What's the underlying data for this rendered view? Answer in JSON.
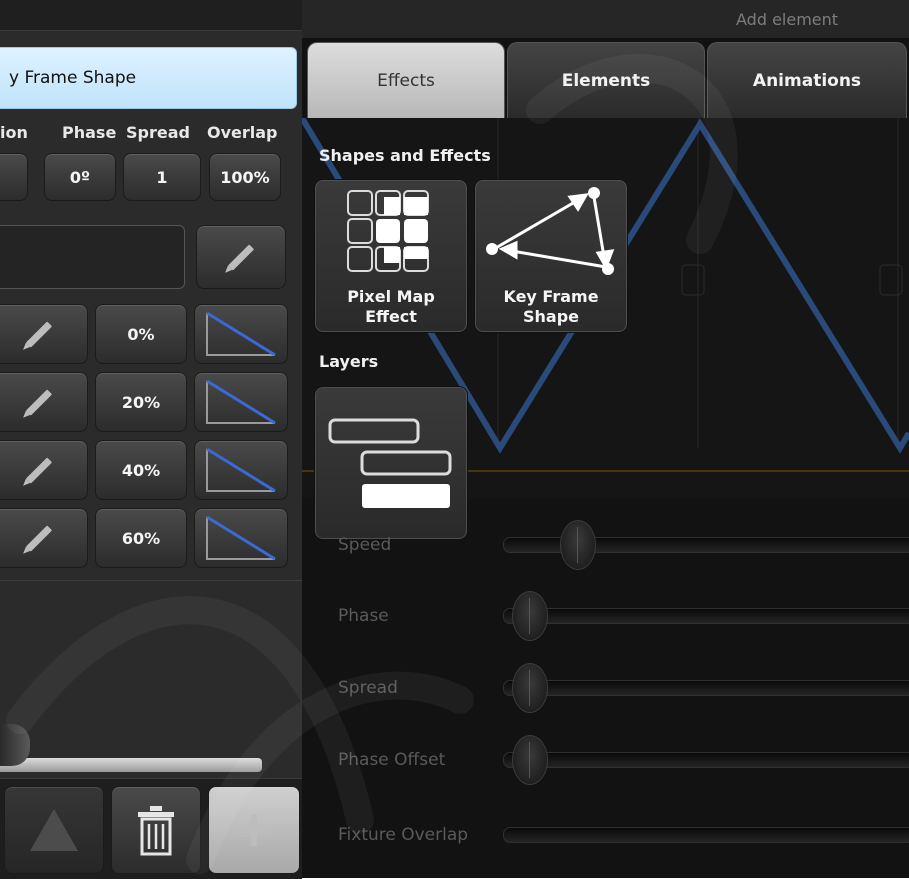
{
  "header": {
    "add_element": "Add element"
  },
  "left_panel": {
    "name_value": "y Frame Shape",
    "columns": [
      "ion",
      "Phase",
      "Spread",
      "Overlap"
    ],
    "values": {
      "phase": "0º",
      "spread": "1",
      "overlap": "100%"
    },
    "layer_rows": [
      {
        "percent": "0%"
      },
      {
        "percent": "20%"
      },
      {
        "percent": "40%"
      },
      {
        "percent": "60%"
      }
    ],
    "icons": {
      "edit": "pencil-icon",
      "ramp": "ramp-curve-icon",
      "up": "triangle-up-icon",
      "delete": "trash-icon",
      "add": "plus-icon"
    }
  },
  "tabs": [
    {
      "label": "Effects",
      "active": true
    },
    {
      "label": "Elements",
      "active": false
    },
    {
      "label": "Animations",
      "active": false
    }
  ],
  "effects_panel": {
    "shapes_title": "Shapes and Effects",
    "tiles": [
      {
        "label_1": "Pixel Map",
        "label_2": "Effect",
        "icon": "pixel-map-icon"
      },
      {
        "label_1": "Key Frame",
        "label_2": "Shape",
        "icon": "key-frame-shape-icon"
      }
    ],
    "layers_title": "Layers",
    "layers_icon": "layers-icon"
  },
  "sliders": [
    {
      "label": "Speed",
      "value": 0.13
    },
    {
      "label": "Phase",
      "value": 0.0
    },
    {
      "label": "Spread",
      "value": 0.0
    },
    {
      "label": "Phase Offset",
      "value": 0.0
    },
    {
      "label": "Fixture Overlap",
      "value": null
    }
  ],
  "colors": {
    "accent_line": "#2a4a7a",
    "active_tab": "#c9c9c9",
    "name_field": "#cfe9fb"
  }
}
